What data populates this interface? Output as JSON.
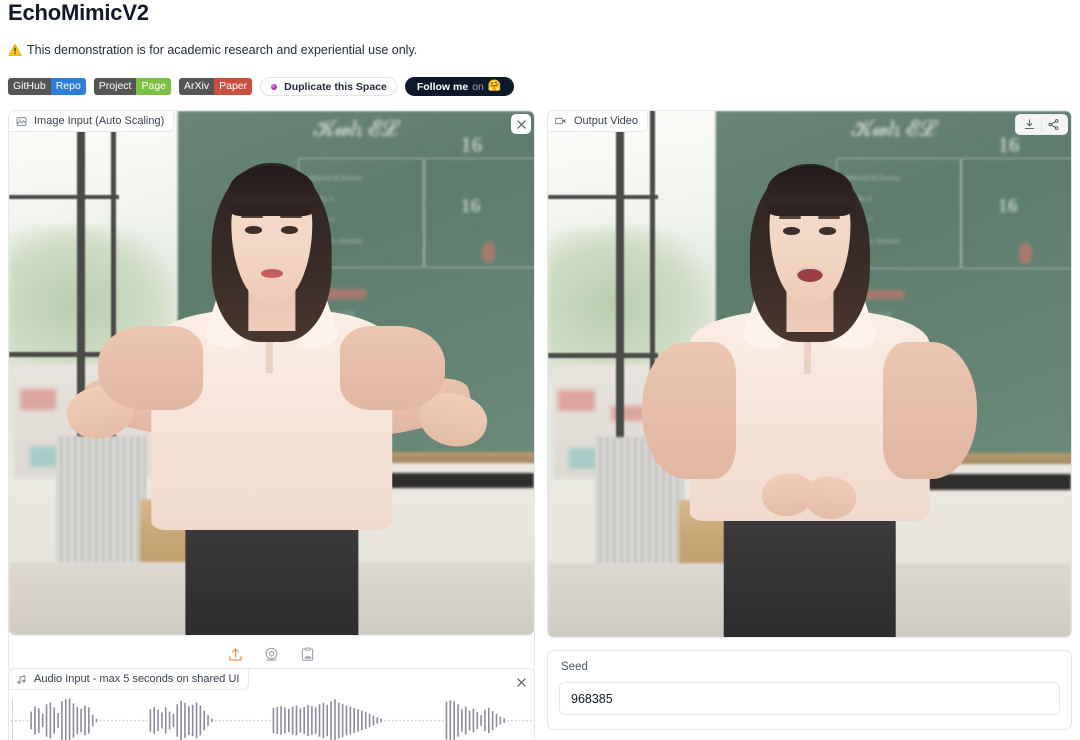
{
  "header": {
    "title": "EchoMimicV2",
    "notice": "This demonstration is for academic research and experiential use only.",
    "warning_icon": "warning-triangle-icon"
  },
  "badges": [
    {
      "name": "github-repo-badge",
      "left_label": "GitHub",
      "right_label": "Repo",
      "right_color": "#2e7dd7"
    },
    {
      "name": "project-page-badge",
      "left_label": "Project",
      "right_label": "Page",
      "right_color": "#7bc043"
    },
    {
      "name": "arxiv-paper-badge",
      "left_label": "ArXiv",
      "right_label": "Paper",
      "right_color": "#c7503f"
    }
  ],
  "buttons": {
    "duplicate_space": "Duplicate this Space",
    "duplicate_icon": "huggingface-dot-icon",
    "follow_prefix": "Follow me",
    "follow_suffix": "on",
    "follow_icon": "huggingface-hug-icon"
  },
  "panels": {
    "image_input": {
      "label": "Image Input (Auto Scaling)",
      "label_icon": "image-icon",
      "close_icon": "close-icon",
      "toolbar": [
        {
          "name": "upload-icon",
          "title": "Upload"
        },
        {
          "name": "webcam-icon",
          "title": "Webcam"
        },
        {
          "name": "clipboard-icon",
          "title": "Paste from clipboard"
        }
      ]
    },
    "output_video": {
      "label": "Output Video",
      "label_icon": "video-camera-icon",
      "tools": [
        {
          "name": "download-icon",
          "title": "Download"
        },
        {
          "name": "share-icon",
          "title": "Share"
        }
      ]
    },
    "audio_input": {
      "label": "Audio Input - max 5 seconds on shared UI",
      "label_icon": "music-note-icon",
      "close_icon": "close-icon"
    },
    "seed": {
      "label": "Seed",
      "value": "968385",
      "placeholder": "Seed"
    }
  },
  "colors": {
    "badge_gray": "#555555",
    "badge_blue": "#2e7dd7",
    "badge_green": "#7bc043",
    "badge_red": "#c7503f",
    "follow_bg": "#0f172a",
    "upload_accent": "#e8864a",
    "panel_border": "#e5e7eb",
    "text": "#1f2937"
  },
  "waveform": {
    "bar_color": "#8b8b9e",
    "dot_color": "#c9c9d3",
    "amplitudes": [
      0.02,
      0.02,
      0.03,
      0.02,
      0.04,
      0.4,
      0.62,
      0.55,
      0.3,
      0.72,
      0.8,
      0.58,
      0.34,
      0.86,
      0.95,
      0.98,
      0.76,
      0.6,
      0.52,
      0.66,
      0.58,
      0.26,
      0.08,
      0.03,
      0.03,
      0.02,
      0.03,
      0.02,
      0.03,
      0.02,
      0.03,
      0.02,
      0.03,
      0.02,
      0.03,
      0.02,
      0.5,
      0.6,
      0.48,
      0.36,
      0.58,
      0.4,
      0.3,
      0.72,
      0.88,
      0.78,
      0.64,
      0.7,
      0.8,
      0.66,
      0.44,
      0.24,
      0.08,
      0.03,
      0.02,
      0.03,
      0.02,
      0.03,
      0.02,
      0.03,
      0.02,
      0.03,
      0.02,
      0.03,
      0.02,
      0.03,
      0.02,
      0.03,
      0.56,
      0.6,
      0.64,
      0.58,
      0.52,
      0.62,
      0.66,
      0.54,
      0.6,
      0.7,
      0.64,
      0.58,
      0.72,
      0.78,
      0.7,
      0.86,
      0.94,
      0.8,
      0.74,
      0.66,
      0.62,
      0.56,
      0.5,
      0.44,
      0.38,
      0.3,
      0.22,
      0.14,
      0.08,
      0.03,
      0.02,
      0.03,
      0.02,
      0.03,
      0.02,
      0.03,
      0.02,
      0.03,
      0.02,
      0.03,
      0.02,
      0.03,
      0.02,
      0.03,
      0.02,
      0.84,
      0.9,
      0.86,
      0.72,
      0.5,
      0.62,
      0.44,
      0.52,
      0.38,
      0.24,
      0.48,
      0.56,
      0.42,
      0.3,
      0.18,
      0.1,
      0.03,
      0.02,
      0.03,
      0.02,
      0.03,
      0.02,
      0.03
    ]
  }
}
